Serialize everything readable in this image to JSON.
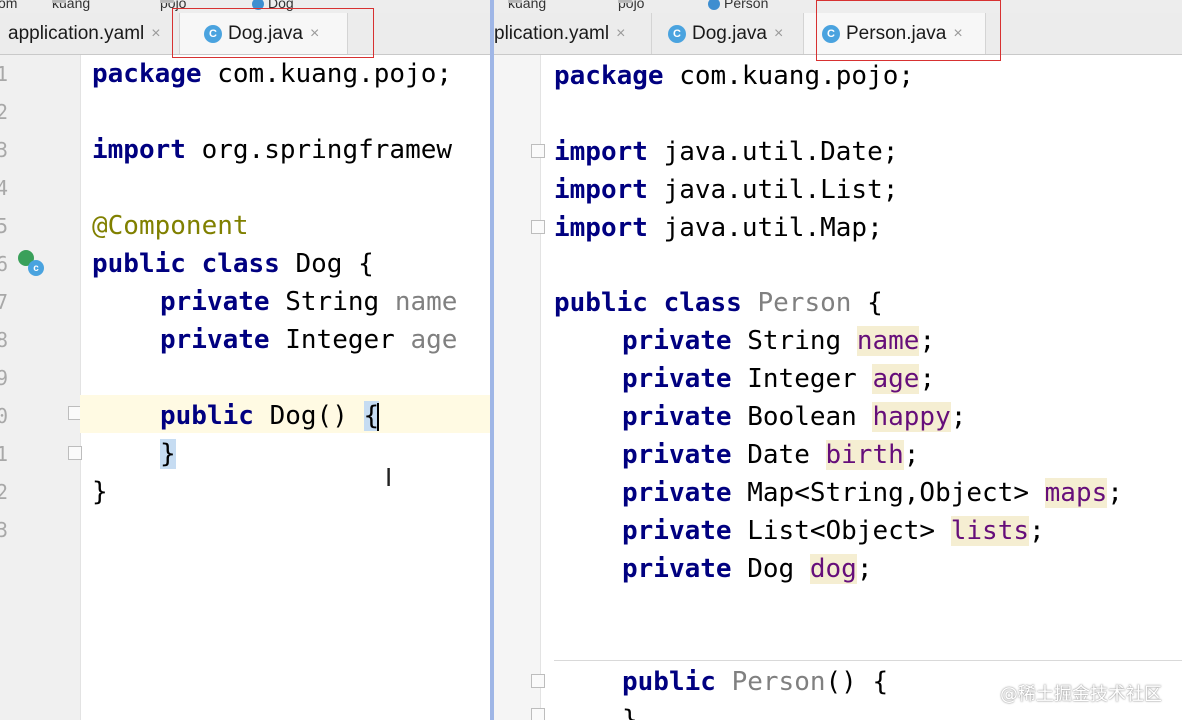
{
  "left": {
    "breadcrumbs": [
      "om",
      "kuang",
      "pojo",
      "Dog"
    ],
    "tabs": [
      {
        "label": "application.yaml",
        "close": "×"
      },
      {
        "label": "Dog.java",
        "close": "×",
        "icon": "C"
      }
    ],
    "line_numbers": [
      "1",
      "2",
      "3",
      "4",
      "5",
      "6",
      "7",
      "8",
      "9",
      "0",
      "1",
      "2",
      "3"
    ],
    "code": {
      "l1_kw": "package",
      "l1_rest": " com.kuang.pojo;",
      "l3_kw": "import",
      "l3_rest": " org.springframew",
      "l5_ann": "@Component",
      "l6_kw": "public class",
      "l6_rest": " Dog {",
      "l7_kw": "private",
      "l7_type": " String ",
      "l7_field": "name",
      "l8_kw": "private",
      "l8_type": " Integer ",
      "l8_field": "age",
      "l10_kw": "public",
      "l10_rest": " Dog() ",
      "l10_brace": "{",
      "l11_brace": "}",
      "l12": "}"
    }
  },
  "right": {
    "breadcrumbs": [
      "kuang",
      "pojo",
      "Person"
    ],
    "tabs": [
      {
        "label": "plication.yaml",
        "close": "×"
      },
      {
        "label": "Dog.java",
        "close": "×",
        "icon": "C"
      },
      {
        "label": "Person.java",
        "close": "×",
        "icon": "C"
      }
    ],
    "code": {
      "l1_kw": "package",
      "l1_rest": " com.kuang.pojo;",
      "l3_kw": "import",
      "l3_rest": " java.util.Date;",
      "l4_kw": "import",
      "l4_rest": " java.util.List;",
      "l5_kw": "import",
      "l5_rest": " java.util.Map;",
      "l7_kw": "public class",
      "l7_name": " Person",
      "l7_rest": " {",
      "f1_kw": "private",
      "f1_type": " String ",
      "f1_field": "name",
      "f1_end": ";",
      "f2_kw": "private",
      "f2_type": " Integer ",
      "f2_field": "age",
      "f2_end": ";",
      "f3_kw": "private",
      "f3_type": " Boolean ",
      "f3_field": "happy",
      "f3_end": ";",
      "f4_kw": "private",
      "f4_type": " Date ",
      "f4_field": "birth",
      "f4_end": ";",
      "f5_kw": "private",
      "f5_type": " Map<String,Object> ",
      "f5_field": "maps",
      "f5_end": ";",
      "f6_kw": "private",
      "f6_type": " List<Object> ",
      "f6_field": "lists",
      "f6_end": ";",
      "f7_kw": "private",
      "f7_type": " Dog ",
      "f7_field": "dog",
      "f7_end": ";",
      "c_kw": "public",
      "c_name": " Person",
      "c_rest": "() {",
      "c_close": "}"
    }
  },
  "watermark": "@稀土掘金技术社区",
  "colors": {
    "keyword": "#000080",
    "annotation": "#808000",
    "field": "#660e7a",
    "highlight_box": "#d73131"
  }
}
